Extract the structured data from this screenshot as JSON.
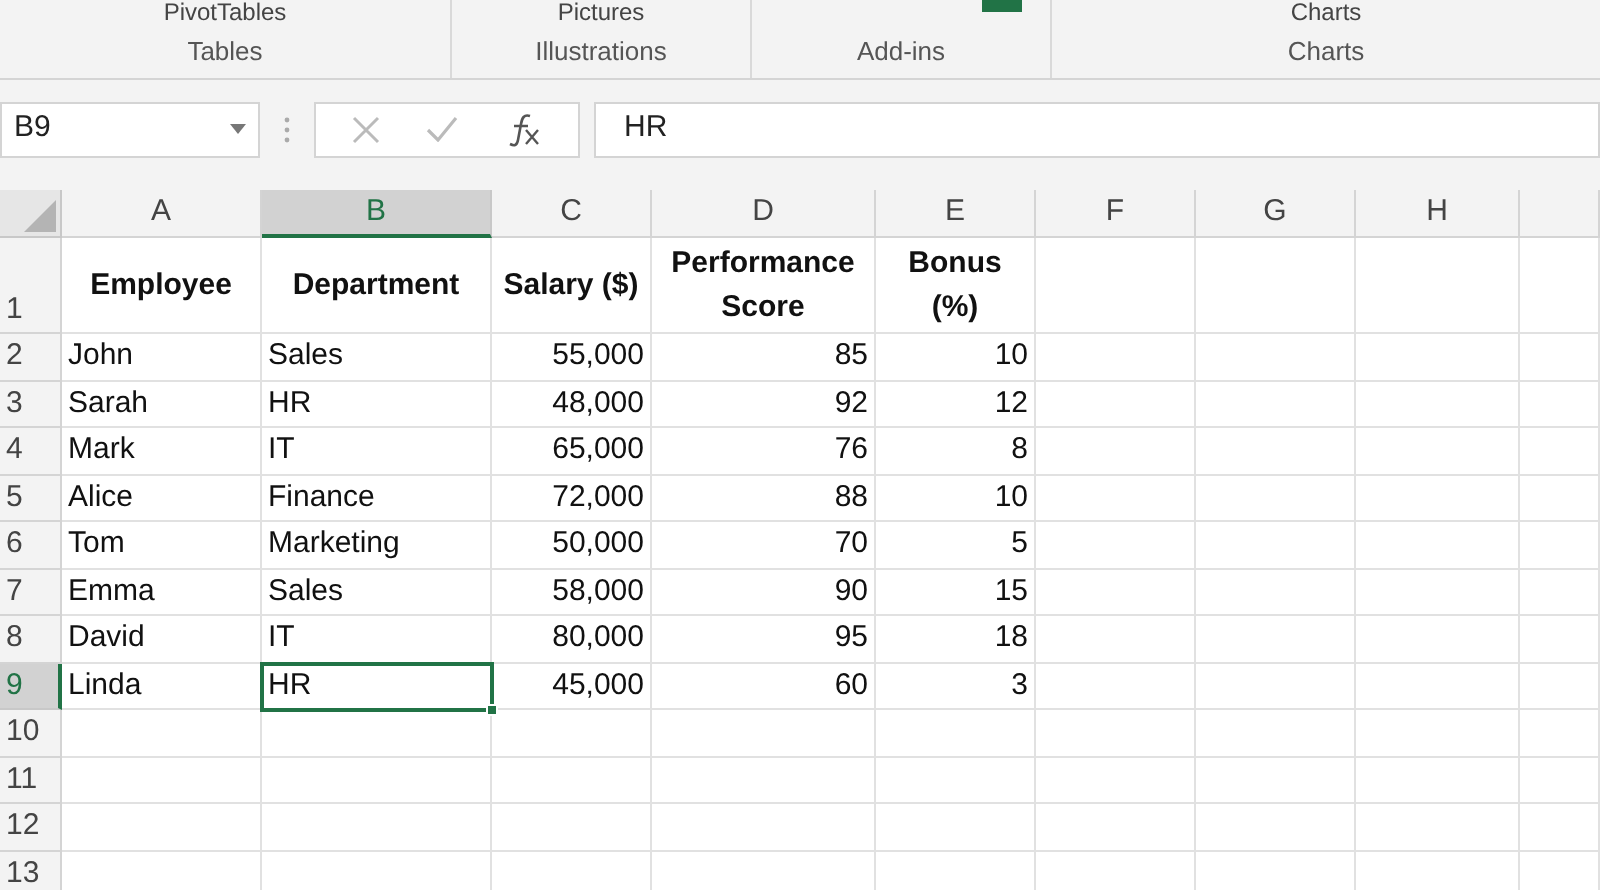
{
  "ribbon": {
    "groups": [
      {
        "button_label": "PivotTables",
        "label": "Tables"
      },
      {
        "button_label": "Pictures",
        "label": "Illustrations"
      },
      {
        "label": "Add-ins"
      },
      {
        "button_label": "Charts",
        "label": "Charts"
      }
    ]
  },
  "formula_bar": {
    "name_box": "B9",
    "formula": "HR"
  },
  "columns": [
    {
      "label": "A",
      "selected": false
    },
    {
      "label": "B",
      "selected": true
    },
    {
      "label": "C",
      "selected": false
    },
    {
      "label": "D",
      "selected": false
    },
    {
      "label": "E",
      "selected": false
    },
    {
      "label": "F",
      "selected": false
    },
    {
      "label": "G",
      "selected": false
    },
    {
      "label": "H",
      "selected": false
    },
    {
      "selected": false
    }
  ],
  "rows": [
    {
      "header": "1",
      "selected": false,
      "cells": [
        "Employee",
        "Department",
        "Salary ($)",
        "Performance Score",
        "Bonus (%)"
      ]
    },
    {
      "header": "2",
      "selected": false,
      "cells": [
        "John",
        "Sales",
        "55,000",
        "85",
        "10"
      ]
    },
    {
      "header": "3",
      "selected": false,
      "cells": [
        "Sarah",
        "HR",
        "48,000",
        "92",
        "12"
      ]
    },
    {
      "header": "4",
      "selected": false,
      "cells": [
        "Mark",
        "IT",
        "65,000",
        "76",
        "8"
      ]
    },
    {
      "header": "5",
      "selected": false,
      "cells": [
        "Alice",
        "Finance",
        "72,000",
        "88",
        "10"
      ]
    },
    {
      "header": "6",
      "selected": false,
      "cells": [
        "Tom",
        "Marketing",
        "50,000",
        "70",
        "5"
      ]
    },
    {
      "header": "7",
      "selected": false,
      "cells": [
        "Emma",
        "Sales",
        "58,000",
        "90",
        "15"
      ]
    },
    {
      "header": "8",
      "selected": false,
      "cells": [
        "David",
        "IT",
        "80,000",
        "95",
        "18"
      ]
    },
    {
      "header": "9",
      "selected": true,
      "cells": [
        "Linda",
        "HR",
        "45,000",
        "60",
        "3"
      ]
    },
    {
      "header": "10",
      "selected": false,
      "cells": []
    },
    {
      "header": "11",
      "selected": false,
      "cells": []
    },
    {
      "header": "12",
      "selected": false,
      "cells": []
    },
    {
      "header": "13",
      "selected": false,
      "cells": []
    }
  ]
}
